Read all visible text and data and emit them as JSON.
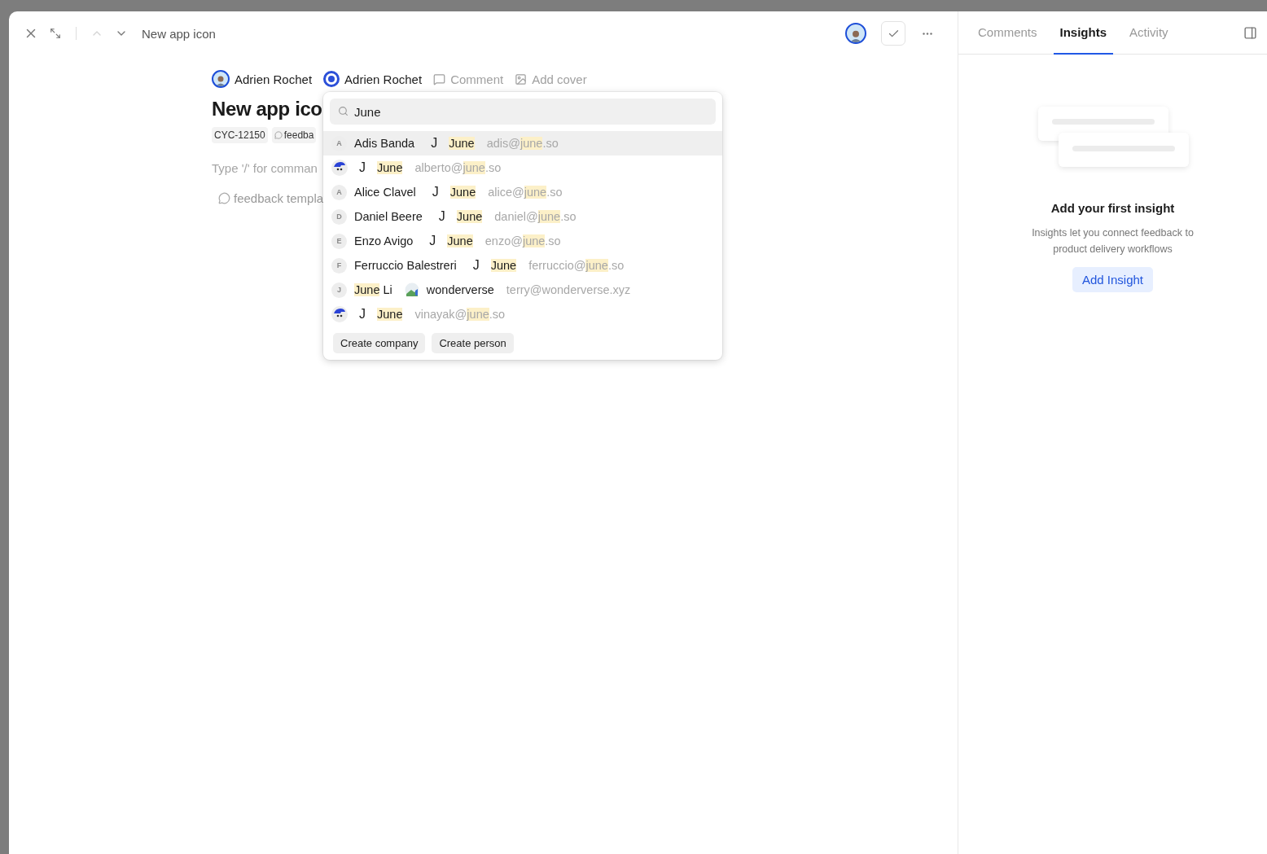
{
  "header": {
    "title": "New app icon",
    "prev_disabled": true,
    "next_disabled": false
  },
  "properties": [
    {
      "kind": "person",
      "label": "Adrien Rochet"
    },
    {
      "kind": "target",
      "label": "Adrien Rochet"
    },
    {
      "kind": "comment",
      "label": "Comment"
    },
    {
      "kind": "cover",
      "label": "Add cover"
    }
  ],
  "title": "New app ico",
  "tags": [
    {
      "kind": "id",
      "label": "CYC-12150"
    },
    {
      "kind": "chat",
      "label": "feedba"
    }
  ],
  "editor_placeholder": "Type '/' for comman",
  "template_label": "feedback templa",
  "picker": {
    "search": {
      "value": "June"
    },
    "rows": [
      {
        "selected": true,
        "avatar": {
          "kind": "initial",
          "letter": "A"
        },
        "name": {
          "rest": "Adis Banda"
        },
        "company": {
          "kind": "letter",
          "logo": "J",
          "name": "June",
          "matched": true
        },
        "email": {
          "before": "adis@",
          "match": "june",
          "after": ".so"
        }
      },
      {
        "selected": false,
        "avatar": {
          "kind": "image"
        },
        "company": {
          "kind": "letter",
          "logo": "J",
          "name": "June",
          "matched": true
        },
        "email": {
          "before": "alberto@",
          "match": "june",
          "after": ".so"
        }
      },
      {
        "selected": false,
        "avatar": {
          "kind": "initial",
          "letter": "A"
        },
        "name": {
          "rest": "Alice Clavel"
        },
        "company": {
          "kind": "letter",
          "logo": "J",
          "name": "June",
          "matched": true
        },
        "email": {
          "before": "alice@",
          "match": "june",
          "after": ".so"
        }
      },
      {
        "selected": false,
        "avatar": {
          "kind": "initial",
          "letter": "D"
        },
        "name": {
          "rest": "Daniel Beere"
        },
        "company": {
          "kind": "letter",
          "logo": "J",
          "name": "June",
          "matched": true
        },
        "email": {
          "before": "daniel@",
          "match": "june",
          "after": ".so"
        }
      },
      {
        "selected": false,
        "avatar": {
          "kind": "initial",
          "letter": "E"
        },
        "name": {
          "rest": "Enzo Avigo"
        },
        "company": {
          "kind": "letter",
          "logo": "J",
          "name": "June",
          "matched": true
        },
        "email": {
          "before": "enzo@",
          "match": "june",
          "after": ".so"
        }
      },
      {
        "selected": false,
        "avatar": {
          "kind": "initial",
          "letter": "F"
        },
        "name": {
          "rest": "Ferruccio Balestreri"
        },
        "company": {
          "kind": "letter",
          "logo": "J",
          "name": "June",
          "matched": true
        },
        "email": {
          "before": "ferruccio@",
          "match": "june",
          "after": ".so"
        }
      },
      {
        "selected": false,
        "avatar": {
          "kind": "initial",
          "letter": "J"
        },
        "name": {
          "match": "June",
          "rest": " Li"
        },
        "company": {
          "kind": "image",
          "name": "wonderverse",
          "matched": false
        },
        "email": {
          "before": "terry@wonderverse.xyz"
        }
      },
      {
        "selected": false,
        "avatar": {
          "kind": "image"
        },
        "company": {
          "kind": "letter",
          "logo": "J",
          "name": "June",
          "matched": true
        },
        "email": {
          "before": "vinayak@",
          "match": "june",
          "after": ".so"
        }
      }
    ],
    "actions": [
      "Create company",
      "Create person"
    ]
  },
  "side": {
    "tabs": [
      {
        "label": "Comments",
        "selected": false
      },
      {
        "label": "Insights",
        "selected": true
      },
      {
        "label": "Activity",
        "selected": false
      }
    ],
    "empty": {
      "title": "Add your first insight",
      "description": "Insights let you connect feedback to product delivery workflows",
      "button": "Add Insight"
    }
  }
}
